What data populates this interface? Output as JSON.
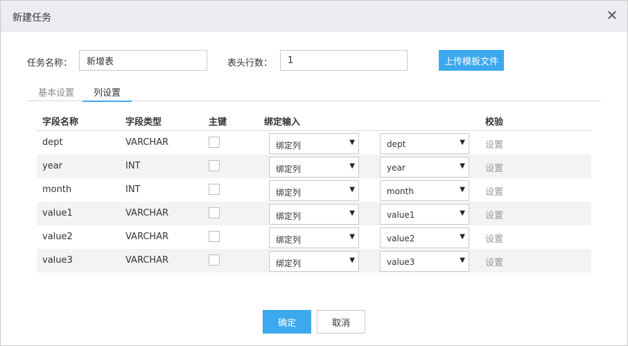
{
  "dialog": {
    "title": "新建任务",
    "close_glyph": "✕"
  },
  "form": {
    "task_name_label": "任务名称：",
    "task_name_value": "新增表",
    "header_rows_label": "表头行数：",
    "header_rows_value": "1",
    "upload_label": "上传模板文件"
  },
  "tabs": [
    {
      "label": "基本设置",
      "active": false
    },
    {
      "label": "列设置",
      "active": true
    }
  ],
  "table": {
    "headers": {
      "field_name": "字段名称",
      "field_type": "字段类型",
      "primary_key": "主键",
      "bind_input": "绑定输入",
      "validate": "校验"
    },
    "rows": [
      {
        "name": "dept",
        "type": "VARCHAR",
        "bind_mode": "绑定列",
        "bind_col": "dept",
        "action": "设置"
      },
      {
        "name": "year",
        "type": "INT",
        "bind_mode": "绑定列",
        "bind_col": "year",
        "action": "设置"
      },
      {
        "name": "month",
        "type": "INT",
        "bind_mode": "绑定列",
        "bind_col": "month",
        "action": "设置"
      },
      {
        "name": "value1",
        "type": "VARCHAR",
        "bind_mode": "绑定列",
        "bind_col": "value1",
        "action": "设置"
      },
      {
        "name": "value2",
        "type": "VARCHAR",
        "bind_mode": "绑定列",
        "bind_col": "value2",
        "action": "设置"
      },
      {
        "name": "value3",
        "type": "VARCHAR",
        "bind_mode": "绑定列",
        "bind_col": "value3",
        "action": "设置"
      }
    ]
  },
  "footer": {
    "ok_label": "确定",
    "cancel_label": "取消"
  },
  "colors": {
    "accent": "#3ca9ee",
    "header_bg": "#ebedf0",
    "row_alt": "#f2f3f5"
  },
  "icons": {
    "dropdown": "▼"
  }
}
